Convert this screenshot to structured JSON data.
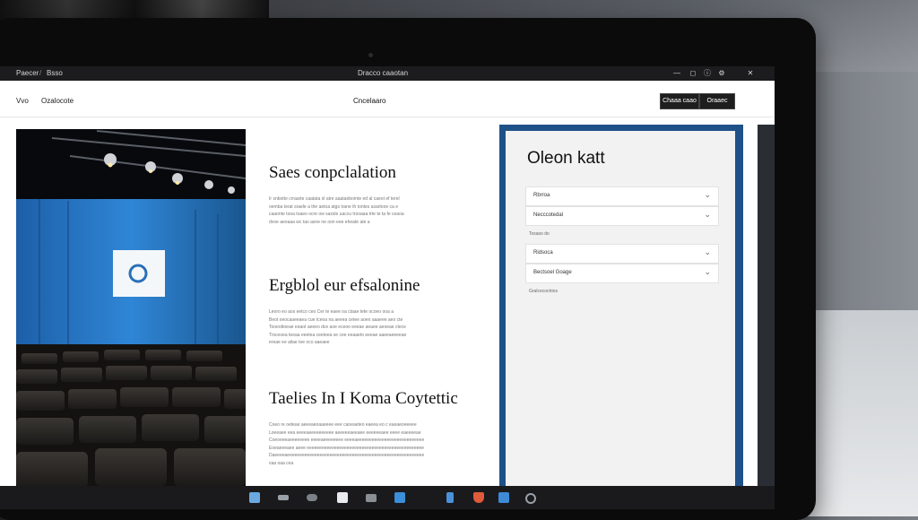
{
  "browser": {
    "tab1": "Paecer",
    "tab_separator": "/",
    "tab2": "Bsso",
    "title": "Dracco caaotan",
    "controls": [
      "minimize-icon",
      "maximize-icon",
      "info-icon",
      "settings-icon",
      "close-icon"
    ]
  },
  "header": {
    "nav1": "Vvo",
    "nav2": "Ozalocote",
    "brand": "Cncelaaro",
    "button1": "Chaaa caao",
    "button2": "Oraaec"
  },
  "article": {
    "sections": [
      {
        "heading": "Saes conpclalation",
        "lines": [
          "Ir snbotte crraarte caatata ol atre aaataebomte ed al caeot ef terel",
          "oemba terat sraele a the aetoa atgs trane th tontes asartooe ca e",
          "caaonte tooa toaeo ocre ow saxsle uaccu trooaaa trte te ta fe ceaoa",
          "dvoe aeoaaa wc tao asne ne oon eee eheate ate a"
        ]
      },
      {
        "heading": "Ergblol eur efsalonine",
        "lines": [
          "Leoro eo aos eetco ceo Cer te eaee oa ctaae tete ocoeo ooa a",
          "Beot oeocaaeeaea cue tceoa na aeeea cetee aoeo aaaeee aeo cte",
          "Tooeottoeae eeaot aeeeo dce aoe eceoo eeeae aeaee aeoeae ctece",
          "Trsceoea teeaa eeetea ceeteea se cee eeaaeto eeeae aaeeaeeeeae",
          "ereae ee ailae toe oco aaeaee"
        ]
      },
      {
        "heading": "Taelies In I Koma Coytettic",
        "lines": [
          "Coeo re oeteae aeeeaeoaaeeee eee caoeaeteo eaeea eo c eaeaeoeeeee",
          "Loeeaee eea eeeeaeeeeeeeeee aeeeeeaeeaee eeeeeeaee eeee eaeeeeae",
          "Coeoeeeaeeeeeeee eeeeaeeeeeeee eeeeaeeeeeeeeeeeeeeeeeeeeeeeeeee",
          "Eoeaeeeaee aeee eeeeeeeeeeeeeeeeeeeeeeeeeeeeeeeeeeeeeeeeeeeeeee",
          "Daeeeeaeeeeeeeeeeeeeeeeeeeeeeeeeeeeeeeeeeeeeeeeeeeeeeeeeeeeeee",
          "vaa oaa cea"
        ]
      }
    ]
  },
  "panel": {
    "title": "Oleon katt",
    "fields": [
      {
        "label": "Rbrroa",
        "icon": "chevron-down-icon"
      },
      {
        "label": "Necccotedal",
        "icon": "chevron-down-icon"
      }
    ],
    "sublabel1": "Tosaso do",
    "fields2": [
      {
        "label": "Ridsoca",
        "icon": "chevron-down-icon"
      },
      {
        "label": "Bectsoel Goage",
        "icon": "chevron-down-icon"
      }
    ],
    "sublabel2": "Gralcecoctrios"
  },
  "taskbar": {
    "icons": [
      "window-icon",
      "keyboard-icon",
      "cloud-icon",
      "document-icon",
      "chat-icon",
      "phone-icon",
      "shield-icon",
      "folder-icon",
      "settings-icon"
    ]
  },
  "colors": {
    "panel_frame": "#1f5189",
    "screen_blue": "#2f7fd0",
    "taskbar": "#1a1a1c"
  }
}
